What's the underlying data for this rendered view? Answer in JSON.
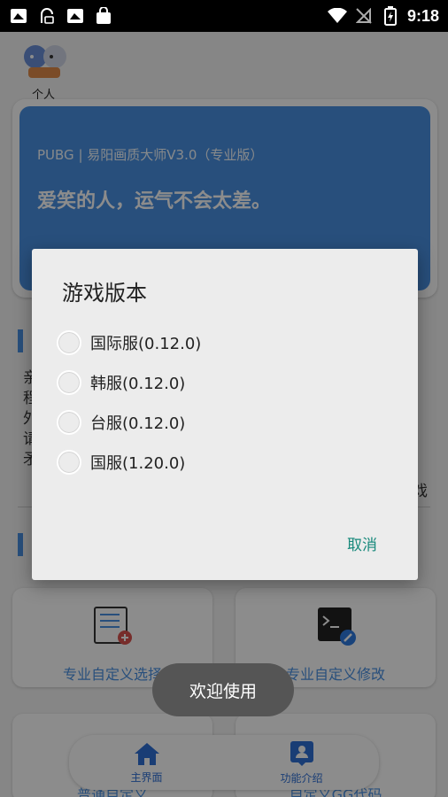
{
  "status_bar": {
    "time": "9:18",
    "left_icons": [
      "image-icon",
      "nfc-icon",
      "image-icon",
      "shopping-bag-icon"
    ],
    "right_icons": [
      "wifi-icon",
      "signal-off-icon",
      "battery-charging-icon"
    ]
  },
  "header": {
    "profile_label": "个人"
  },
  "banner": {
    "title": "PUBG | 易阳画质大师V3.0（专业版）",
    "subtitle": "爱笑的人，运气不会太差。"
  },
  "feature_cards": [
    {
      "label": "专业自定义选择"
    },
    {
      "label": "专业自定义修改"
    },
    {
      "label": "普通自定义"
    },
    {
      "label": "自定义GG代码"
    }
  ],
  "bottom_nav": [
    {
      "label": "主界面",
      "icon": "home-icon"
    },
    {
      "label": "功能介绍",
      "icon": "contact-card-icon"
    }
  ],
  "dialog": {
    "title": "游戏版本",
    "options": [
      {
        "label": "国际服(0.12.0)",
        "checked": false
      },
      {
        "label": "韩服(0.12.0)",
        "checked": false
      },
      {
        "label": "台服(0.12.0)",
        "checked": false
      },
      {
        "label": "国服(1.20.0)",
        "checked": false
      }
    ],
    "cancel_label": "取消"
  },
  "toast": {
    "text": "欢迎使用"
  },
  "colors": {
    "accent": "#4a90e2",
    "dialog_action": "#17897b"
  }
}
